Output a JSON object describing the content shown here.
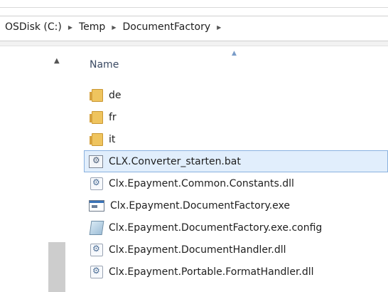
{
  "breadcrumb": {
    "items": [
      "OSDisk (C:)",
      "Temp",
      "DocumentFactory"
    ]
  },
  "column_header": {
    "name": "Name"
  },
  "files": [
    {
      "name": "de",
      "icon": "folder-icon"
    },
    {
      "name": "fr",
      "icon": "folder-icon"
    },
    {
      "name": "it",
      "icon": "folder-icon"
    },
    {
      "name": "CLX.Converter_starten.bat",
      "icon": "batch-file-icon",
      "selected": true
    },
    {
      "name": "Clx.Epayment.Common.Constants.dll",
      "icon": "dll-file-icon"
    },
    {
      "name": "Clx.Epayment.DocumentFactory.exe",
      "icon": "exe-file-icon"
    },
    {
      "name": "Clx.Epayment.DocumentFactory.exe.config",
      "icon": "config-file-icon"
    },
    {
      "name": "Clx.Epayment.DocumentHandler.dll",
      "icon": "dll-file-icon"
    },
    {
      "name": "Clx.Epayment.Portable.FormatHandler.dll",
      "icon": "dll-file-icon"
    }
  ],
  "colors": {
    "selection_bg": "#e1eefc",
    "selection_border": "#8ab2e0",
    "folder": "#efc45e"
  }
}
